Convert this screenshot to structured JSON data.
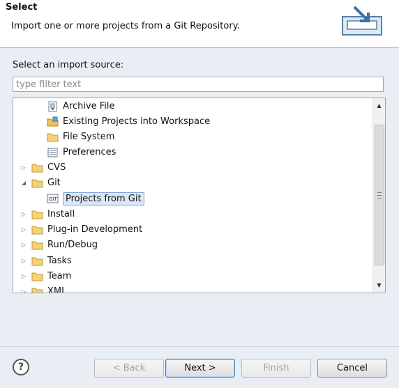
{
  "header": {
    "title": "Select",
    "description": "Import one or more projects from a Git Repository."
  },
  "source": {
    "label": "Select an import source:",
    "filter_placeholder": "type filter text"
  },
  "tree": {
    "items": [
      {
        "label": "Archive File",
        "icon": "archive-file-icon"
      },
      {
        "label": "Existing Projects into Workspace",
        "icon": "projects-folder-icon"
      },
      {
        "label": "File System",
        "icon": "folder-icon"
      },
      {
        "label": "Preferences",
        "icon": "preferences-icon"
      },
      {
        "label": "CVS",
        "icon": "folder-icon"
      },
      {
        "label": "Git",
        "icon": "folder-icon"
      },
      {
        "label": "Projects from Git",
        "icon": "git-projects-icon"
      },
      {
        "label": "Install",
        "icon": "folder-icon"
      },
      {
        "label": "Plug-in Development",
        "icon": "folder-icon"
      },
      {
        "label": "Run/Debug",
        "icon": "folder-icon"
      },
      {
        "label": "Tasks",
        "icon": "folder-icon"
      },
      {
        "label": "Team",
        "icon": "folder-icon"
      },
      {
        "label": "XML",
        "icon": "folder-icon"
      }
    ]
  },
  "buttons": {
    "help": "?",
    "back": "< Back",
    "next": "Next >",
    "finish": "Finish",
    "cancel": "Cancel"
  },
  "colors": {
    "selection": "#dbe7f6",
    "folder": "#e8c15a"
  }
}
